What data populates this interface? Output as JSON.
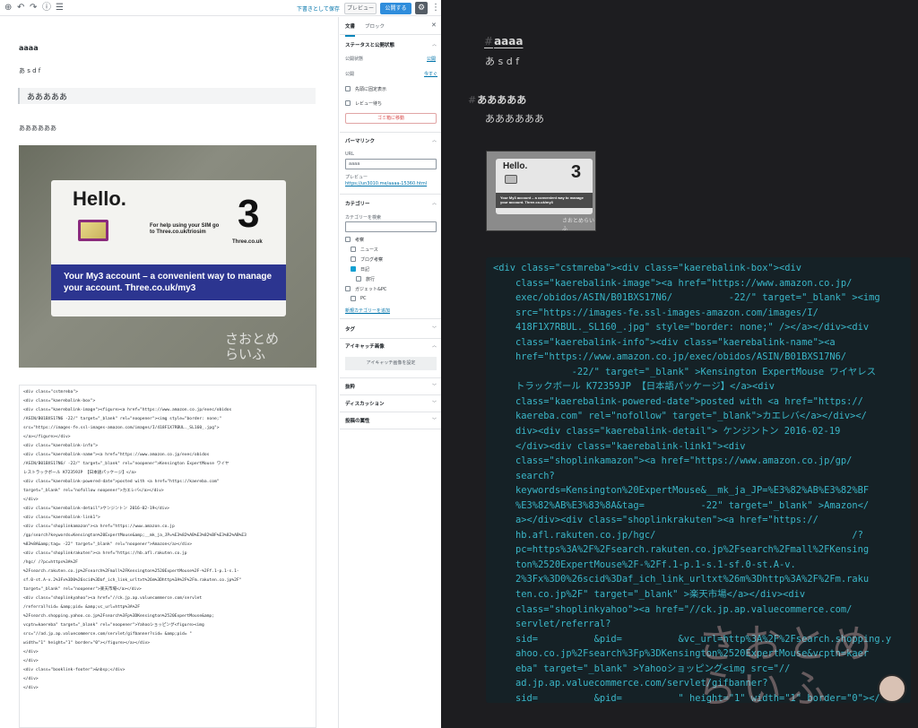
{
  "toolbar": {
    "add_icon": "⊕",
    "undo_icon": "↶",
    "redo_icon": "↷",
    "info_icon": "ⓘ",
    "outline_icon": "☰",
    "save_draft": "下書きとして保存",
    "preview": "プレビュー",
    "publish": "公開する",
    "settings_icon": "⚙",
    "more_icon": "⋮"
  },
  "editor": {
    "title": "aaaa",
    "paragraph1": "あ s d f",
    "heading": "あああああ",
    "paragraph2": "ああああああ",
    "image": {
      "hello": "Hello.",
      "help_text": "For help using your SIM go to Three.co.uk/triosim",
      "three_logo": "3",
      "three_domain": "Three.co.uk",
      "banner": "Your My3 account – a convenient way to manage your account. Three.co.uk/my3",
      "watermark": "さおとめらいふ"
    },
    "code_lines": [
      "<div class=\"cstmreba\">",
      "<div class=\"kaerebalink-box\">",
      "<div class=\"kaerebalink-image\"><figure><a href=\"https://www.amazon.co.jp/exec/obidos",
      "/ASIN/B01BXS17N6          -22/\" target=\"_blank\" rel=\"noopener\"><img style=\"border: none;\"",
      "src=\"https://images-fe.ssl-images-amazon.com/images/I/418F1X7RBUL._SL160_.jpg\">",
      "</a></figure></div>",
      "<div class=\"kaerebalink-info\">",
      "<div class=\"kaerebalink-name\"><a href=\"https://www.amazon.co.jp/exec/obidos",
      "/ASIN/B01BXS17N6/          -22/\" target=\"_blank\" rel=\"noopener\">Kensington ExpertMouse ワイヤ",
      "レストラックボール K72359JP 【日本語パッケージ】</a>",
      "<div class=\"kaerebalink-powered-date\">posted with <a href=\"https://kaereba.com\"",
      "target=\"_blank\" rel=\"nofollow noopener\">カエレバ</a></div>",
      "</div>",
      "<div class=\"kaerebalink-detail\">ケンジントン 2016-02-19</div>",
      "<div class=\"kaerebalink-link1\">",
      "<div class=\"shoplinkamazon\"><a href=\"https://www.amazon.co.jp",
      "/gp/search?keywords=Kensington%20ExpertMouse&amp;__mk_ja_JP=%E3%82%AB%E3%82%BF%E3%82%AB%E3",
      "%83%8A&amp;tag=          -22\" target=\"_blank\" rel=\"noopener\">Amazon</a></div>",
      "<div class=\"shoplinkrakuten\"><a href=\"https://hb.afl.rakuten.co.jp",
      "/hgc/                          /?pc=https%3A%2F",
      "%2Fsearch.rakuten.co.jp%2Fsearch%2Fmall%2FKensington%2520ExpertMouse%2F-%2Ff.1-p.1-s.1-",
      "sf.0-st.A-v.2%3Fx%3D0%26scid%3Daf_ich_link_urltxt%26m%3Dhttp%3A%2F%2Fm.rakuten.co.jp%2F\"",
      "target=\"_blank\" rel=\"noopener\">楽天市場</a></div>",
      "<div class=\"shoplinkyahoo\"><a href=\"//ck.jp.ap.valuecommerce.com/servlet",
      "/referral?sid=          &amp;pid=          &amp;vc_url=http%3A%2F",
      "%2Fsearch.shopping.yahoo.co.jp%2Fsearch%3Fp%3DKensington%2520ExpertMouse&amp;",
      "vcptn=kaereba\" target=\"_blank\" rel=\"noopener\">Yahooショッピング<figure><img",
      "src=\"//ad.jp.ap.valuecommerce.com/servlet/gifbanner?sid=          &amp;pid=          \"",
      "width=\"1\" height=\"1\" border=\"0\"></figure></a></div>",
      "</div>",
      "</div>",
      "<div class=\"booklink-footer\">&nbsp;</div>",
      "</div>",
      "</div>"
    ]
  },
  "sidebar": {
    "tab_document": "文書",
    "tab_block": "ブロック",
    "close_icon": "✕",
    "status_section": "ステータスと公開状態",
    "visibility_label": "公開状態",
    "visibility_value": "公開",
    "publish_label": "公開",
    "publish_value": "今すぐ",
    "sticky_label": "先頭に固定表示",
    "pending_label": "レビュー待ち",
    "trash_button": "ゴミ箱に移動",
    "permalink_section": "パーマリンク",
    "url_label": "URL",
    "url_value": "aaaa",
    "preview_label": "プレビュー",
    "preview_link": "https://un3010.me/aaaa-15360.html",
    "category_section": "カテゴリー",
    "category_search_label": "カテゴリーを検索",
    "categories": [
      {
        "label": "考察",
        "checked": false,
        "indent": 0
      },
      {
        "label": "ニュース",
        "checked": false,
        "indent": 1
      },
      {
        "label": "ブログ考察",
        "checked": false,
        "indent": 1
      },
      {
        "label": "日記",
        "checked": true,
        "indent": 1
      },
      {
        "label": "旅行",
        "checked": false,
        "indent": 2
      },
      {
        "label": "ガジェット&PC",
        "checked": false,
        "indent": 0
      },
      {
        "label": "PC",
        "checked": false,
        "indent": 1
      }
    ],
    "add_category": "新規カテゴリーを追加",
    "tags_section": "タグ",
    "featured_section": "アイキャッチ画像",
    "featured_button": "アイキャッチ画像を設定",
    "excerpt_section": "抜粋",
    "discussion_section": "ディスカッション",
    "attributes_section": "投稿の属性",
    "chevron_up": "︿",
    "chevron_down": "﹀"
  },
  "preview": {
    "hash": "#",
    "title": "aaaa",
    "paragraph1": "あ s d f",
    "heading": "あああああ",
    "paragraph2": "ああああああ",
    "code_lines": [
      "<div class=\"cstmreba\"><div class=\"kaerebalink-box\"><div",
      "    class=\"kaerebalink-image\"><a href=\"https://www.amazon.co.jp/",
      "    exec/obidos/ASIN/B01BXS17N6/          -22/\" target=\"_blank\" ><img",
      "    src=\"https://images-fe.ssl-images-amazon.com/images/I/",
      "    418F1X7RBUL._SL160_.jpg\" style=\"border: none;\" /></a></div><div",
      "    class=\"kaerebalink-info\"><div class=\"kaerebalink-name\"><a",
      "    href=\"https://www.amazon.co.jp/exec/obidos/ASIN/B01BXS17N6/",
      "              -22/\" target=\"_blank\" >Kensington ExpertMouse ワイヤレス",
      "    トラックボール K72359JP 【日本語パッケージ】</a><div",
      "    class=\"kaerebalink-powered-date\">posted with <a href=\"https://",
      "    kaereba.com\" rel=\"nofollow\" target=\"_blank\">カエレバ</a></div></",
      "    div><div class=\"kaerebalink-detail\"> ケンジントン 2016-02-19",
      "    </div><div class=\"kaerebalink-link1\"><div",
      "    class=\"shoplinkamazon\"><a href=\"https://www.amazon.co.jp/gp/",
      "    search?",
      "    keywords=Kensington%20ExpertMouse&__mk_ja_JP=%E3%82%AB%E3%82%BF",
      "    %E3%82%AB%E3%83%8A&tag=          -22\" target=\"_blank\" >Amazon</",
      "    a></div><div class=\"shoplinkrakuten\"><a href=\"https://",
      "    hb.afl.rakuten.co.jp/hgc/                                   /?",
      "    pc=https%3A%2F%2Fsearch.rakuten.co.jp%2Fsearch%2Fmall%2FKensing",
      "    ton%2520ExpertMouse%2F-%2Ff.1-p.1-s.1-sf.0-st.A-v.",
      "    2%3Fx%3D0%26scid%3Daf_ich_link_urltxt%26m%3Dhttp%3A%2F%2Fm.raku",
      "    ten.co.jp%2F\" target=\"_blank\" >楽天市場</a></div><div",
      "    class=\"shoplinkyahoo\"><a href=\"//ck.jp.ap.valuecommerce.com/",
      "    servlet/referral?",
      "    sid=          &pid=          &vc_url=http%3A%2F%2Fsearch.shopping.y",
      "    ahoo.co.jp%2Fsearch%3Fp%3DKensington%2520ExpertMouse&vcptn=kaer",
      "    eba\" target=\"_blank\" >Yahooショッピング<img src=\"//",
      "    ad.jp.ap.valuecommerce.com/servlet/gifbanner?",
      "    sid=          &pid=          \" height=\"1\" width=\"1\" border=\"0\"></",
      "    a></div></div></div><div class=\"booklink-footer\"></div></div></",
      "    div>"
    ],
    "watermark": "さおとめ らいふ"
  },
  "colors": {
    "accent": "#2f8ddc",
    "link": "#0073aa",
    "code_text": "#3ab6c8",
    "preview_bg": "#1d1d20",
    "code_bg": "#152126",
    "trash": "#d94f4f"
  }
}
